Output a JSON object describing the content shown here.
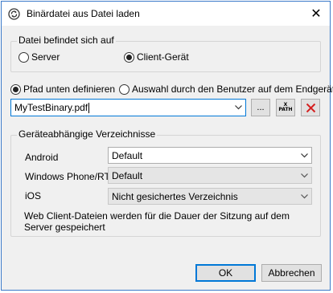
{
  "window": {
    "title": "Binärdatei aus Datei laden",
    "title_icon": "binary-file-icon",
    "close_glyph": "✕"
  },
  "location_group": {
    "title": "Datei befindet sich auf",
    "options": [
      {
        "label": "Server",
        "selected": false
      },
      {
        "label": "Client-Gerät",
        "selected": true
      }
    ]
  },
  "path_mode": {
    "options": [
      {
        "label": "Pfad unten definieren",
        "selected": true
      },
      {
        "label": "Auswahl durch den Benutzer auf dem Endgerät",
        "selected": false
      }
    ]
  },
  "file_path": {
    "value": "MyTestBinary.pdf",
    "browse_label": "...",
    "xpath_label_top": "X",
    "xpath_label_bottom": "PATH",
    "delete_icon": "delete-x-icon"
  },
  "device_dirs": {
    "title": "Geräteabhängige Verzeichnisse",
    "rows": [
      {
        "label": "Android",
        "value": "Default",
        "enabled": true
      },
      {
        "label": "Windows Phone/RT",
        "value": "Default",
        "enabled": false
      },
      {
        "label": "iOS",
        "value": "Nicht gesichertes Verzeichnis",
        "enabled": false
      }
    ],
    "info": "Web Client-Dateien werden für die Dauer der Sitzung auf dem Server gespeichert"
  },
  "buttons": {
    "ok": "OK",
    "cancel": "Abbrechen"
  },
  "colors": {
    "accent": "#0078d7",
    "delete_red": "#d42020",
    "window_border": "#3b7ac9"
  }
}
